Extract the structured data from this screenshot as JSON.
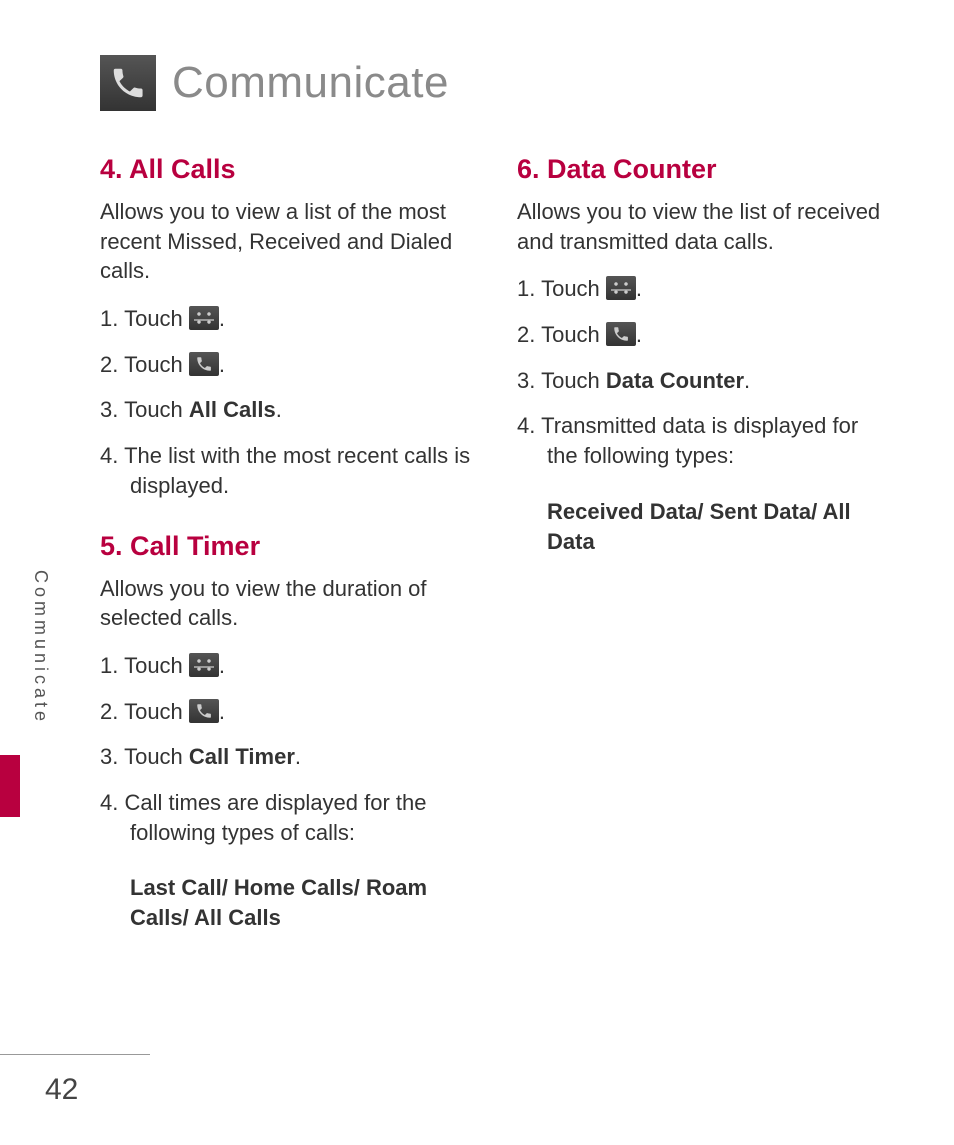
{
  "header": {
    "title": "Communicate"
  },
  "side_label": "Communicate",
  "page_number": "42",
  "left": {
    "s4": {
      "title": "4. All Calls",
      "intro": "Allows you to view a list of the most recent Missed, Received and Dialed calls.",
      "steps": {
        "s1_a": "Touch ",
        "s1_b": ".",
        "s2_a": "Touch ",
        "s2_b": ".",
        "s3_a": "Touch ",
        "s3_bold": "All Calls",
        "s3_b": ".",
        "s4": "The list with the most recent calls is displayed."
      }
    },
    "s5": {
      "title": "5. Call Timer",
      "intro": "Allows you to view the duration of selected calls.",
      "steps": {
        "s1_a": "Touch ",
        "s1_b": ".",
        "s2_a": "Touch ",
        "s2_b": ".",
        "s3_a": "Touch ",
        "s3_bold": "Call Timer",
        "s3_b": ".",
        "s4": "Call times are displayed for the following types of calls:"
      },
      "sub": "Last Call/ Home Calls/ Roam Calls/ All Calls"
    }
  },
  "right": {
    "s6": {
      "title": "6. Data Counter",
      "intro": "Allows you to view the list of received and transmitted data calls.",
      "steps": {
        "s1_a": "Touch ",
        "s1_b": ".",
        "s2_a": "Touch ",
        "s2_b": ".",
        "s3_a": "Touch ",
        "s3_bold": "Data Counter",
        "s3_b": ".",
        "s4": "Transmitted data is displayed for the following types:"
      },
      "sub": "Received Data/ Sent Data/ All Data"
    }
  }
}
